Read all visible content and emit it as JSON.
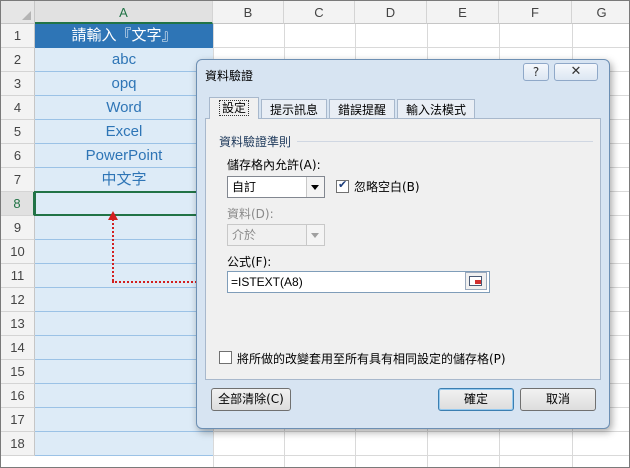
{
  "sheet": {
    "columns": [
      "A",
      "B",
      "C",
      "D",
      "E",
      "F",
      "G"
    ],
    "rows": [
      "1",
      "2",
      "3",
      "4",
      "5",
      "6",
      "7",
      "8",
      "9",
      "10",
      "11",
      "12",
      "13",
      "14",
      "15",
      "16",
      "17",
      "18"
    ],
    "column_a": [
      "請輸入『文字』",
      "abc",
      "opq",
      "Word",
      "Excel",
      "PowerPoint",
      "中文字",
      ""
    ]
  },
  "dialog": {
    "title": "資料驗證",
    "help_glyph": "?",
    "close_glyph": "✕",
    "tabs": [
      "設定",
      "提示訊息",
      "錯誤提醒",
      "輸入法模式"
    ],
    "group_title": "資料驗證準則",
    "allow_label": "儲存格內允許(A):",
    "allow_value": "自訂",
    "ignore_blank_label": "忽略空白(B)",
    "ignore_blank_checked": true,
    "data_label": "資料(D):",
    "data_value": "介於",
    "formula_label": "公式(F):",
    "formula_value": "=ISTEXT(A8)",
    "apply_all_label": "將所做的改變套用至所有具有相同設定的儲存格(P)",
    "apply_all_checked": false,
    "clear_all_button": "全部清除(C)",
    "ok_button": "確定",
    "cancel_button": "取消"
  },
  "colors": {
    "header_fill": "#2e75b6",
    "cell_fill": "#ddebf7",
    "cell_text": "#2e75b6",
    "active_border": "#217346",
    "arrow": "#d21f1f"
  }
}
